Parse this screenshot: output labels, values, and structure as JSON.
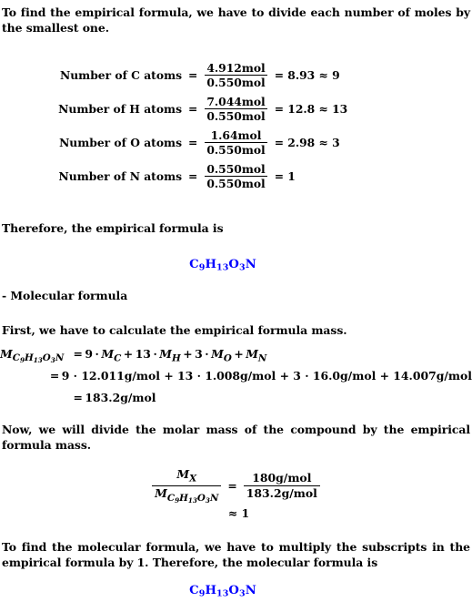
{
  "intro": {
    "text": "To find the empirical formula, we have to divide each number of moles by the smallest one."
  },
  "mole_ratios": {
    "rows": [
      {
        "label": "Number of C atoms",
        "equals": "=",
        "numerator": "4.912mol",
        "denominator": "0.550mol",
        "result": "= 8.93 ≈ 9"
      },
      {
        "label": "Number of H atoms",
        "equals": "=",
        "numerator": "7.044mol",
        "denominator": "0.550mol",
        "result": "= 12.8 ≈ 13"
      },
      {
        "label": "Number of O atoms",
        "equals": "=",
        "numerator": "1.64mol",
        "denominator": "0.550mol",
        "result": "= 2.98 ≈ 3"
      },
      {
        "label": "Number of N atoms",
        "equals": "=",
        "numerator": "0.550mol",
        "denominator": "0.550mol",
        "result": "= 1"
      }
    ]
  },
  "therefore_empirical": {
    "text": "Therefore, the empirical formula is"
  },
  "empirical_formula": {
    "element_1": "C",
    "sub_1": "9",
    "element_2": "H",
    "sub_2": "13",
    "element_3": "O",
    "sub_3": "3",
    "element_4": "N",
    "color": "#0000ff"
  },
  "molecular_heading": {
    "text": "- Molecular formula"
  },
  "first_step": {
    "text": "First, we have to calculate the empirical formula mass."
  },
  "molar_mass": {
    "symbol": "M",
    "subscript_parts": [
      {
        "el": "C",
        "n": "9"
      },
      {
        "el": "H",
        "n": "13"
      },
      {
        "el": "O",
        "n": "3"
      },
      {
        "el": "N",
        "n": ""
      }
    ],
    "line1": {
      "equals": "=",
      "terms": [
        {
          "coef": "9",
          "dot": "·",
          "sym": "M",
          "sub": "C"
        },
        {
          "plus": "+",
          "coef": "13",
          "dot": "·",
          "sym": "M",
          "sub": "H"
        },
        {
          "plus": "+",
          "coef": "3",
          "dot": "·",
          "sym": "M",
          "sub": "O"
        },
        {
          "plus": "+",
          "coef": "",
          "dot": "",
          "sym": "M",
          "sub": "N"
        }
      ]
    },
    "line2": {
      "equals": "=",
      "text": "9 · 12.011g/mol + 13 · 1.008g/mol + 3 · 16.0g/mol + 14.007g/mol"
    },
    "line3": {
      "equals": "=",
      "text": "183.2g/mol"
    }
  },
  "divide_step": {
    "text": "Now, we will divide the molar mass of the compound by the empirical formula mass."
  },
  "ratio_fraction": {
    "num_symbol": "M",
    "num_subscript": "X",
    "den_symbol": "M",
    "den_subscript_parts": [
      {
        "el": "C",
        "n": "9"
      },
      {
        "el": "H",
        "n": "13"
      },
      {
        "el": "O",
        "n": "3"
      },
      {
        "el": "N",
        "n": ""
      }
    ],
    "equals": "=",
    "right_numerator": "180g/mol",
    "right_denominator": "183.2g/mol",
    "approx_line": "≈ 1"
  },
  "final_step": {
    "text": "To find the molecular formula, we have to multiply the subscripts in the empirical formula by 1. Therefore, the molecular formula is"
  },
  "molecular_formula": {
    "element_1": "C",
    "sub_1": "9",
    "element_2": "H",
    "sub_2": "13",
    "element_3": "O",
    "sub_3": "3",
    "element_4": "N",
    "color": "#0000ff"
  }
}
